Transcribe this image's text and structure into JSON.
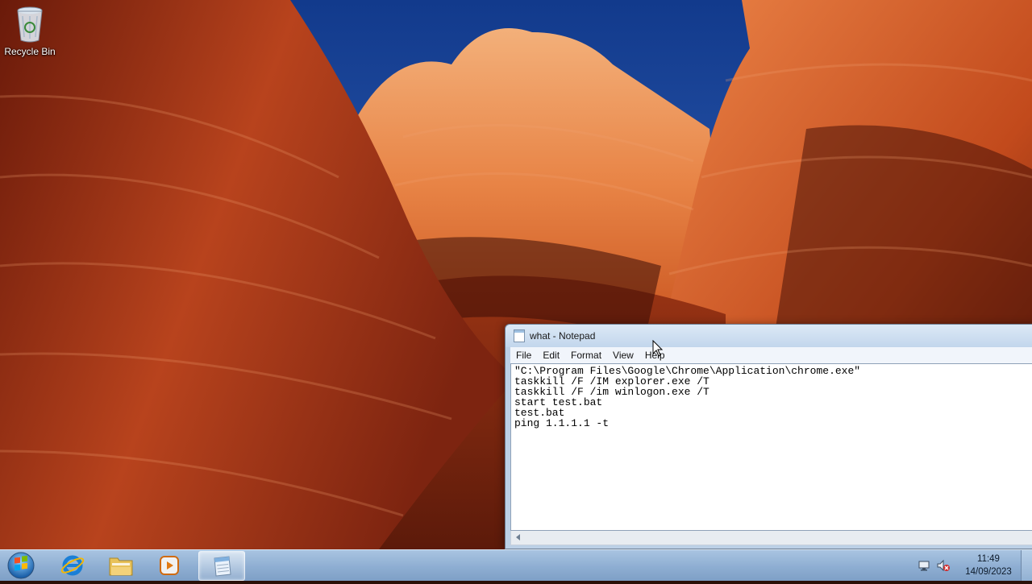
{
  "desktop": {
    "icons": [
      {
        "label": "Recycle Bin",
        "icon": "recycle-bin-icon"
      }
    ]
  },
  "notepad": {
    "title": "what - Notepad",
    "icon": "notepad-icon",
    "menu": [
      "File",
      "Edit",
      "Format",
      "View",
      "Help"
    ],
    "content": "\"C:\\Program Files\\Google\\Chrome\\Application\\chrome.exe\"\ntaskkill /F /IM explorer.exe /T\ntaskkill /F /im winlogon.exe /T\nstart test.bat\ntest.bat\nping 1.1.1.1 -t"
  },
  "taskbar": {
    "start_icon": "windows-start-orb-icon",
    "pinned": [
      {
        "name": "internet-explorer",
        "icon": "internet-explorer-icon"
      },
      {
        "name": "windows-explorer",
        "icon": "folder-icon"
      },
      {
        "name": "media-player",
        "icon": "media-player-icon"
      },
      {
        "name": "notepad",
        "icon": "notepad-icon",
        "active": true
      }
    ],
    "tray": {
      "icons": [
        "network-icon",
        "volume-muted-icon"
      ],
      "time": "11:49",
      "date": "14/09/2023"
    }
  },
  "colors": {
    "sky": "#1d4fa8",
    "rock_dark": "#7a1f0b",
    "rock_orange": "#e2622a",
    "taskbar": "#8eaed2"
  }
}
